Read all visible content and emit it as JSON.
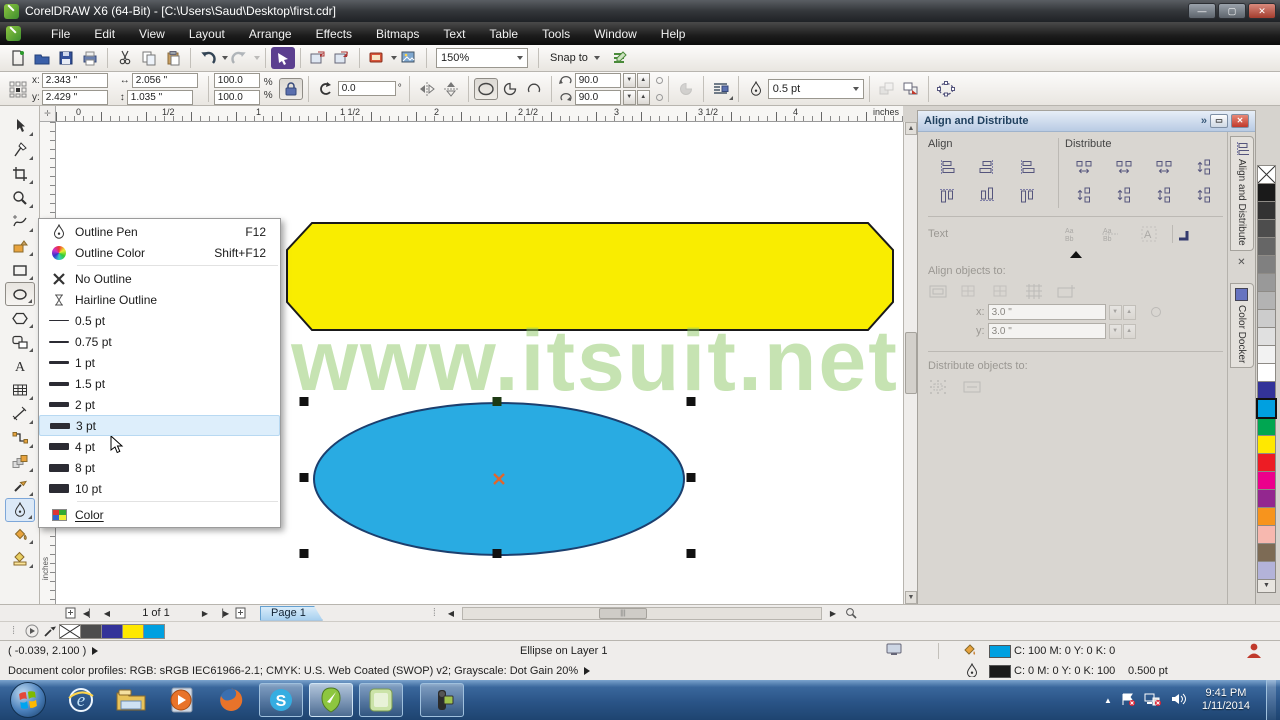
{
  "window": {
    "title": "CorelDRAW X6 (64-Bit) - [C:\\Users\\Saud\\Desktop\\first.cdr]",
    "minimize": "—",
    "maximize": "▢",
    "close": "✕"
  },
  "menu_bar": {
    "items": [
      "File",
      "Edit",
      "View",
      "Layout",
      "Arrange",
      "Effects",
      "Bitmaps",
      "Text",
      "Table",
      "Tools",
      "Window",
      "Help"
    ]
  },
  "standard_toolbar": {
    "zoom_level": "150%",
    "snap_to_label": "Snap to"
  },
  "property_bar": {
    "x_label": "x:",
    "y_label": "y:",
    "x_value": "2.343 \"",
    "y_value": "2.429 \"",
    "width_value": "2.056 \"",
    "height_value": "1.035 \"",
    "scale_h": "100.0",
    "scale_v": "100.0",
    "percent": "%",
    "rotation_value": "0.0",
    "degree": "°",
    "start_angle": "90.0",
    "end_angle": "90.0",
    "outline_width": "0.5 pt"
  },
  "ruler": {
    "labels": [
      "0",
      "1/2",
      "1",
      "1 1/2",
      "2",
      "2 1/2",
      "3",
      "3 1/2",
      "4"
    ],
    "units": "inches"
  },
  "outline_flyout": {
    "items": [
      {
        "label": "Outline Pen",
        "shortcut": "F12"
      },
      {
        "label": "Outline Color",
        "shortcut": "Shift+F12"
      },
      {
        "label": "No Outline",
        "shortcut": ""
      },
      {
        "label": "Hairline Outline",
        "shortcut": ""
      },
      {
        "label": "0.5 pt",
        "shortcut": ""
      },
      {
        "label": "0.75 pt",
        "shortcut": ""
      },
      {
        "label": "1 pt",
        "shortcut": ""
      },
      {
        "label": "1.5 pt",
        "shortcut": ""
      },
      {
        "label": "2 pt",
        "shortcut": ""
      },
      {
        "label": "3 pt",
        "shortcut": ""
      },
      {
        "label": "4 pt",
        "shortcut": ""
      },
      {
        "label": "8 pt",
        "shortcut": ""
      },
      {
        "label": "10 pt",
        "shortcut": ""
      },
      {
        "label": "Color",
        "shortcut": ""
      }
    ]
  },
  "canvas": {
    "watermark": "www.itsuit.net",
    "octagon_fill": "#f9ed00",
    "ellipse_fill": "#29abe2"
  },
  "docker": {
    "title": "Align and Distribute",
    "chevron": "»",
    "align_label": "Align",
    "distribute_label": "Distribute",
    "text_label": "Text",
    "align_objects_label": "Align objects to:",
    "x_label": "x:",
    "y_label": "y:",
    "x_value": "3.0 \"",
    "y_value": "3.0 \"",
    "distribute_objects_label": "Distribute objects to:",
    "tab_align": "Align and Distribute",
    "tab_color": "Color Docker"
  },
  "color_palette": {
    "colors": [
      "#1a1a1a",
      "#333333",
      "#4d4d4d",
      "#666666",
      "#808080",
      "#999999",
      "#b3b3b3",
      "#cccccc",
      "#e0e0e0",
      "#f2f2f2",
      "#ffffff",
      "#333399",
      "#00a0e0",
      "#00a651",
      "#ffe800",
      "#ed1c24",
      "#ec008c",
      "#93278f",
      "#f7941d",
      "#f7b8af",
      "#7d6b55",
      "#b3b3d9"
    ]
  },
  "page_nav": {
    "page_info": "1 of 1",
    "page_tab": "Page 1"
  },
  "document_palette": {
    "colors": [
      "#4d4d4d",
      "#333399",
      "#ffe800",
      "#00a0e0"
    ]
  },
  "status_bar": {
    "cursor_position": "( -0.039, 2.100 )",
    "object_info": "Ellipse on Layer 1",
    "color_profiles": "Document color profiles: RGB: sRGB IEC61966-2.1; CMYK: U.S. Web Coated (SWOP) v2; Grayscale: Dot Gain 20%",
    "fill_values": "C: 100 M: 0 Y: 0 K: 0",
    "outline_values": "C: 0 M: 0 Y: 0 K: 100",
    "outline_width": "0.500 pt",
    "fill_swatch": "#00a0e0",
    "outline_swatch": "#1a1a1a"
  },
  "taskbar": {
    "time": "9:41 PM",
    "date": "1/11/2014"
  }
}
